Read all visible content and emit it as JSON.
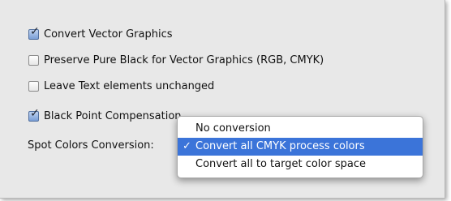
{
  "options": {
    "convert_vector": {
      "label": "Convert Vector Graphics",
      "checked": true
    },
    "preserve_black": {
      "label": "Preserve Pure Black for Vector Graphics (RGB, CMYK)",
      "checked": false
    },
    "leave_text": {
      "label": "Leave Text elements unchanged",
      "checked": false
    },
    "black_point": {
      "label": "Black Point Compensation",
      "checked": true
    }
  },
  "check_glyph": "✓",
  "spot_colors": {
    "label": "Spot Colors Conversion:",
    "menu_items": [
      {
        "label": "No conversion",
        "selected": false
      },
      {
        "label": "Convert all CMYK process colors",
        "selected": true
      },
      {
        "label": "Convert all to target color space",
        "selected": false
      }
    ]
  }
}
